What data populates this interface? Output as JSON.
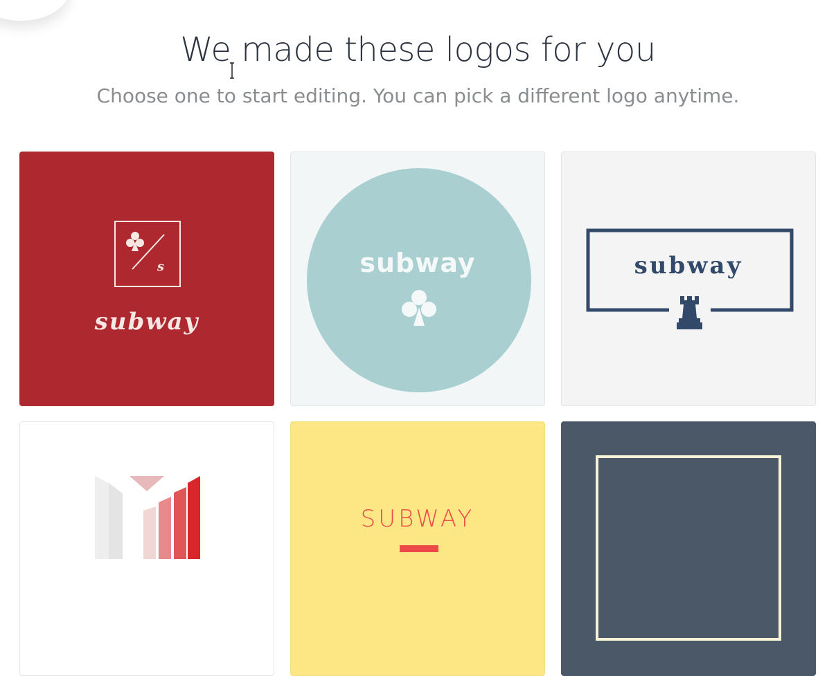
{
  "header": {
    "title": "We made these logos for you",
    "subtitle": "Choose one to start editing. You can pick a different logo anytime."
  },
  "logos": [
    {
      "name": "subway",
      "emblem_letter": "s",
      "background": "#ad282f",
      "icon": "club-icon"
    },
    {
      "name": "subway",
      "background": "#f2f6f7",
      "accent": "#a9cfd0",
      "icon": "club-icon"
    },
    {
      "name": "subway",
      "background": "#f4f4f4",
      "accent": "#33496a",
      "icon": "rook-icon"
    },
    {
      "background": "#ffffff",
      "accent": "#d9262a",
      "icon": "m-bars-icon"
    },
    {
      "name": "SUBWAY",
      "background": "#fde784",
      "accent": "#ec4a4a"
    },
    {
      "background": "#4a5867",
      "accent": "#f6f3d6"
    }
  ]
}
